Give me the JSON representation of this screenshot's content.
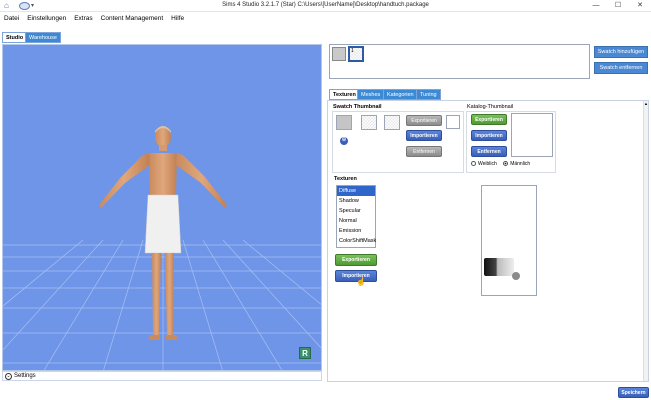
{
  "window": {
    "title": "Sims 4 Studio 3.2.1.7 (Star)  C:\\Users\\[UserName]\\Desktop\\handtuch.package",
    "minimize_label": "—",
    "maximize_label": "☐",
    "close_label": "✕"
  },
  "menu": [
    "Datei",
    "Einstellungen",
    "Extras",
    "Content Management",
    "Hilfe"
  ],
  "main_tabs": [
    "Studio",
    "Warehouse"
  ],
  "viewport": {
    "badge": "R",
    "settings_label": "Settings"
  },
  "swatches": {
    "count_label": "1",
    "add_button": "Swatch hinzufügen",
    "remove_button": "Swatch entfernen"
  },
  "panel_tabs": [
    "Texturen",
    "Meshes",
    "Kategorien",
    "Tuning"
  ],
  "swatch_thumbnail": {
    "title": "Swatch Thumbnail",
    "export": "Exportieren",
    "import": "Importieren",
    "remove": "Entfernen"
  },
  "catalog_thumbnail": {
    "title": "Katalog-Thumbnail",
    "export": "Exportieren",
    "import": "Importieren",
    "remove": "Entfernen",
    "female": "Weiblich",
    "male": "Männlich",
    "selected_gender": "Männlich"
  },
  "textures": {
    "title": "Texturen",
    "items": [
      "Diffuse",
      "Shadow",
      "Specular",
      "Normal",
      "Emission",
      "ColorShiftMask"
    ],
    "selected": "Diffuse",
    "export": "Exportieren",
    "import": "Importieren"
  },
  "footer": {
    "save_button": "Speichern"
  },
  "colors": {
    "accent_blue": "#3d8ad4",
    "viewport_bg": "#6f95e8",
    "button_green": "#4f9a34",
    "button_blue": "#3a5fb8"
  }
}
